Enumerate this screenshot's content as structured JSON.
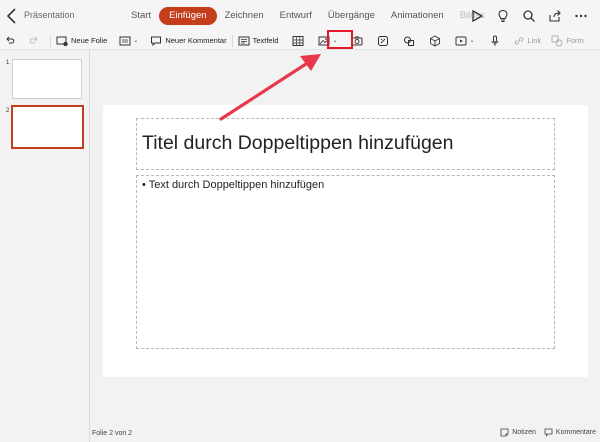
{
  "header": {
    "document_title": "Präsentation",
    "tabs": [
      {
        "label": "Start",
        "active": false
      },
      {
        "label": "Einfügen",
        "active": true
      },
      {
        "label": "Zeichnen",
        "active": false
      },
      {
        "label": "Entwurf",
        "active": false
      },
      {
        "label": "Übergänge",
        "active": false
      },
      {
        "label": "Animationen",
        "active": false
      },
      {
        "label": "Bildsc",
        "active": false
      }
    ],
    "right_icons": [
      "play-icon",
      "lightbulb-icon",
      "search-icon",
      "share-icon",
      "more-icon"
    ]
  },
  "ribbon": {
    "new_slide": "Neue Folie",
    "new_comment": "Neuer Kommentar",
    "textbox": "Textfeld",
    "link": "Link",
    "form": "Form"
  },
  "thumbnails": [
    {
      "number": "1",
      "selected": false
    },
    {
      "number": "2",
      "selected": true
    }
  ],
  "slide": {
    "title_placeholder": "Titel durch Doppeltippen hinzufügen",
    "body_placeholder": "• Text durch Doppeltippen hinzufügen"
  },
  "status": {
    "slide_counter": "Folie 2 von 2",
    "notes": "Notizen",
    "comments": "Kommentare"
  },
  "colors": {
    "accent": "#c43e1c",
    "annotation_red": "#e5182c"
  }
}
